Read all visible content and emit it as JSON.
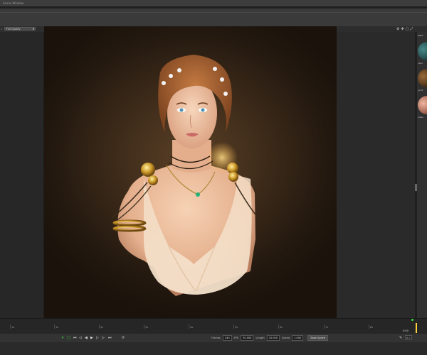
{
  "window": {
    "title": "Scene Window"
  },
  "viewport": {
    "quality_select": "Full Quality",
    "left_label": "Q",
    "icons": [
      "gear-icon",
      "move-icon",
      "frame-icon",
      "expand-icon"
    ]
  },
  "materials": {
    "header": "Mate",
    "items": [
      {
        "label": "cellu",
        "color": "#2f5a5a"
      },
      {
        "label": "goldi",
        "color": "#5a3a1a"
      },
      {
        "label": "bless",
        "color": "#b46e5a"
      }
    ]
  },
  "timeline": {
    "ticks": [
      "1s",
      "1s",
      "2s",
      "3s",
      "4s",
      "5s",
      "6s",
      "7s",
      "8s"
    ],
    "current_time": "0:00"
  },
  "transport": {
    "frames_label": "Frames",
    "frames_value": "240",
    "fps_label": "FPS",
    "fps_value": "30.000",
    "length_label": "Length",
    "length_value": "10.000",
    "speed_label": "Speed",
    "speed_value": "1.000",
    "bake_label": "Bake Speed",
    "frame_value": "0.0"
  },
  "colors": {
    "accent": "#ffd23c",
    "status": "#39e039"
  }
}
